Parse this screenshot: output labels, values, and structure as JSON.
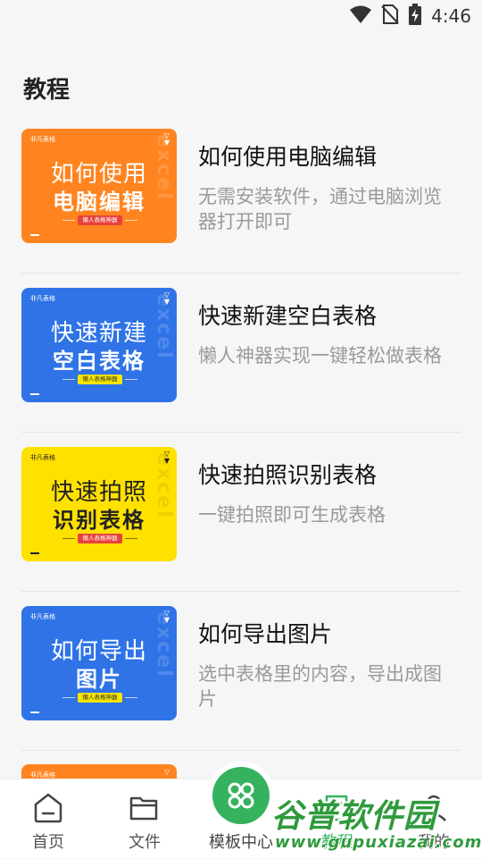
{
  "status_bar": {
    "time": "4:46",
    "icons": [
      "wifi-icon",
      "no-sim-icon",
      "battery-charging-icon"
    ]
  },
  "page_title": "教程",
  "tutorials": [
    {
      "title": "如何使用电脑编辑",
      "desc": "无需安装软件，通过电脑浏览器打开即可",
      "thumb_line1": "如何使用",
      "thumb_line2": "电脑编辑",
      "thumb_pill": "懒人表格神器",
      "thumb_brand": "非凡表格",
      "theme": "orange"
    },
    {
      "title": "快速新建空白表格",
      "desc": "懒人神器实现一键轻松做表格",
      "thumb_line1": "快速新建",
      "thumb_line2": "空白表格",
      "thumb_pill": "懒人表格神器",
      "thumb_brand": "非凡表格",
      "theme": "blue"
    },
    {
      "title": "快速拍照识别表格",
      "desc": "一键拍照即可生成表格",
      "thumb_line1": "快速拍照",
      "thumb_line2": "识别表格",
      "thumb_pill": "懒人表格神器",
      "thumb_brand": "非凡表格",
      "theme": "yellow"
    },
    {
      "title": "如何导出图片",
      "desc": "选中表格里的内容，导出成图片",
      "thumb_line1": "如何导出",
      "thumb_line2": "图片",
      "thumb_pill": "懒人表格神器",
      "thumb_brand": "非凡表格",
      "theme": "blue"
    }
  ],
  "thumb_watermark": "excel",
  "partial_item": {
    "thumb_brand": "非凡表格"
  },
  "bottom_nav": {
    "home": "首页",
    "files": "文件",
    "templates": "模板中心",
    "tutorial": "教程",
    "mine": "我的"
  },
  "site_watermark": {
    "title": "谷普软件园",
    "url": "www.gupuxiazai.com"
  },
  "colors": {
    "orange": "#ff8420",
    "blue": "#2f73e6",
    "yellow": "#ffe100",
    "green": "#35b25e",
    "watermark_green": "#2f9a3c"
  }
}
